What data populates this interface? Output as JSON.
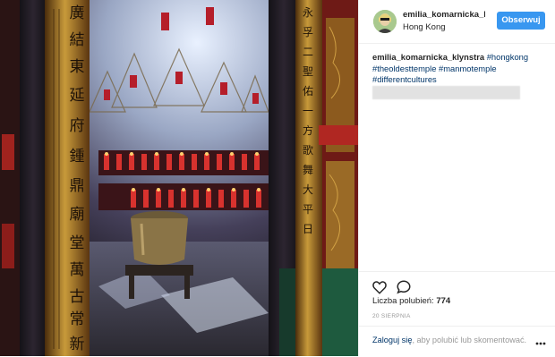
{
  "post": {
    "username": "emilia_komarnicka_klynstra",
    "location": "Hong Kong",
    "follow_label": "Obserwuj",
    "caption_author": "emilia_komarnicka_klynstra",
    "hashtags": [
      "#hongkong",
      "#theoldesttemple",
      "#manmotemple",
      "#differentcultures"
    ],
    "likes_label": "Liczba polubień:",
    "likes_count": "774",
    "date": "20 sierpnia",
    "login_link": "Zaloguj się",
    "login_rest": ", aby polubić lub skomentować."
  },
  "photo": {
    "pillar_characters_left": [
      "廣",
      "結",
      "東",
      "延",
      "府",
      "鍾",
      "鼎",
      "廟",
      "堂",
      "萬",
      "古",
      "常",
      "新"
    ],
    "pillar_characters_right": [
      "永",
      "孚",
      "二",
      "聖",
      "佑",
      "一",
      "方",
      "歌",
      "舞",
      "大",
      "平",
      "日"
    ]
  },
  "icons": {
    "like": "heart-icon",
    "comment": "speech-bubble-icon",
    "more": "ellipsis-icon"
  },
  "colors": {
    "follow_button": "#3897f0",
    "link": "#003569",
    "text": "#262626",
    "muted": "#999999"
  }
}
